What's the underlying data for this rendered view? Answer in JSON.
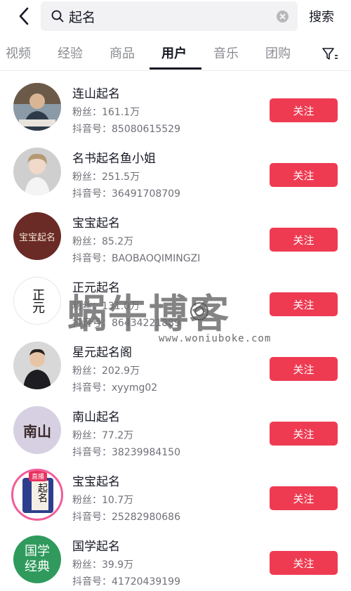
{
  "header": {
    "back_icon": "chevron-left-icon",
    "search_value": "起名",
    "search_button": "搜索"
  },
  "tabs": [
    {
      "label": "视频",
      "active": false
    },
    {
      "label": "经验",
      "active": false
    },
    {
      "label": "商品",
      "active": false
    },
    {
      "label": "用户",
      "active": true
    },
    {
      "label": "音乐",
      "active": false
    },
    {
      "label": "团购",
      "active": false
    }
  ],
  "filter_icon": "filter-icon",
  "users": [
    {
      "name": "连山起名",
      "fans": "粉丝：161.1万",
      "douyin_id": "抖音号：85080615529",
      "follow": "关注"
    },
    {
      "name": "名书起名鱼小姐",
      "fans": "粉丝：251.5万",
      "douyin_id": "抖音号：36491708709",
      "follow": "关注"
    },
    {
      "name": "宝宝起名",
      "fans": "粉丝：85.2万",
      "douyin_id": "抖音号：BAOBAOQIMINGZI",
      "follow": "关注",
      "avatar_text": "宝宝起名"
    },
    {
      "name": "正元起名",
      "fans": "粉丝：131.0万",
      "douyin_id": "抖音号：86434221889",
      "follow": "关注",
      "avatar_text": "正元"
    },
    {
      "name": "星元起名阁",
      "fans": "粉丝：202.9万",
      "douyin_id": "抖音号：xyymg02",
      "follow": "关注"
    },
    {
      "name": "南山起名",
      "fans": "粉丝：77.2万",
      "douyin_id": "抖音号：38239984150",
      "follow": "关注",
      "avatar_text": "南山"
    },
    {
      "name": "宝宝起名",
      "fans": "粉丝：10.7万",
      "douyin_id": "抖音号：25282980686",
      "follow": "关注",
      "avatar_text": "起名",
      "live_badge": "直播"
    },
    {
      "name": "国学起名",
      "fans": "粉丝：39.9万",
      "douyin_id": "抖音号：41720439199",
      "follow": "关注",
      "avatar_text_1": "国学",
      "avatar_text_2": "经典"
    }
  ],
  "watermark": {
    "main": "蜗牛博客",
    "url": "www.woniuboke.com"
  },
  "colors": {
    "accent": "#ee3b52",
    "text": "#161823",
    "secondary": "#6f7078"
  }
}
